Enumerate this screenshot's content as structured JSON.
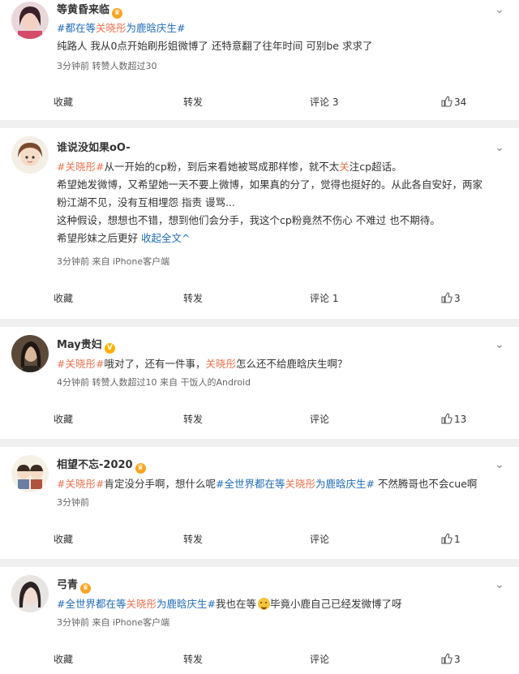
{
  "posts": [
    {
      "username": "等黄昏来临",
      "lines": [
        [
          {
            "t": "#",
            "c": "tag"
          },
          {
            "t": "都在等",
            "c": "tag"
          },
          {
            "t": "关晓彤",
            "c": "hl"
          },
          {
            "t": "为鹿晗庆生#",
            "c": "tag"
          }
        ],
        [
          {
            "t": "纯路人 我从0点开始刷彤姐微博了 还特意翻了往年时间 可别be 求求了",
            "c": ""
          }
        ]
      ],
      "meta": "3分钟前 转赞人数超过30",
      "actions": {
        "fav": "收藏",
        "repost": "转发",
        "comment": "评论 3",
        "like": "34"
      }
    },
    {
      "username": "谁说没如果oO-",
      "lines": [
        [
          {
            "t": "#关晓彤#",
            "c": "hl"
          },
          {
            "t": "从一开始的cp粉，到后来看她被骂成那样惨，就不太",
            "c": ""
          },
          {
            "t": "关",
            "c": "hl"
          },
          {
            "t": "注cp超话。",
            "c": ""
          }
        ],
        [
          {
            "t": "希望她发微博，又希望她一天不要上微博，如果真的分了，觉得也挺好的。从此各自安好，两家",
            "c": ""
          }
        ],
        [
          {
            "t": "粉江湖不见，没有互相埋怨 指责 谩骂...",
            "c": ""
          }
        ],
        [
          {
            "t": "这种假设，想想也不错，想到他们会分手，我这个cp粉竟然不伤心 不难过 也不期待。",
            "c": ""
          }
        ],
        [
          {
            "t": "希望彤妹之后更好 ",
            "c": ""
          },
          {
            "t": "收起全文^",
            "c": "lk"
          }
        ]
      ],
      "meta": "3分钟前 来自 iPhone客户端",
      "actions": {
        "fav": "收藏",
        "repost": "转发",
        "comment": "评论 1",
        "like": "3"
      }
    },
    {
      "username": "May贵妇",
      "lines": [
        [
          {
            "t": "#关晓彤#",
            "c": "hl"
          },
          {
            "t": "哦对了，还有一件事，",
            "c": ""
          },
          {
            "t": "关晓彤",
            "c": "hl"
          },
          {
            "t": "怎么还不给鹿晗庆生啊？",
            "c": ""
          }
        ]
      ],
      "meta": "4分钟前 转赞人数超过10 来自 干饭人的Android",
      "actions": {
        "fav": "收藏",
        "repost": "转发",
        "comment": "评论",
        "like": "13"
      }
    },
    {
      "username": "相望不忘-2020",
      "lines": [
        [
          {
            "t": "#关晓彤#",
            "c": "hl"
          },
          {
            "t": "肯定没分手啊，想什么呢",
            "c": ""
          },
          {
            "t": "#全世界都在等",
            "c": "tag"
          },
          {
            "t": "关晓彤",
            "c": "hl"
          },
          {
            "t": "为鹿晗庆生#",
            "c": "tag"
          },
          {
            "t": " 不然腾哥也不会cue啊",
            "c": ""
          }
        ]
      ],
      "meta": "3分钟前",
      "actions": {
        "fav": "收藏",
        "repost": "转发",
        "comment": "评论",
        "like": "1"
      }
    },
    {
      "username": "弓青",
      "lines": [
        [
          {
            "t": "#全世界都在等",
            "c": "tag"
          },
          {
            "t": "关晓彤",
            "c": "hl"
          },
          {
            "t": "为鹿晗庆生#",
            "c": "tag"
          },
          {
            "t": "我也在等",
            "c": ""
          },
          {
            "t": "EMOJI",
            "c": "emoji"
          },
          {
            "t": "毕竟小鹿自己已经发微博了呀",
            "c": ""
          }
        ]
      ],
      "meta": "3分钟前 来自 iPhone客户端",
      "actions": {
        "fav": "收藏",
        "repost": "转发",
        "comment": "评论",
        "like": "3"
      }
    }
  ],
  "icons": {
    "like": "thumbs-up-icon",
    "more": "chevron-down-icon",
    "badge": "crown-icon"
  },
  "colors": {
    "highlight": "#eb7350",
    "link": "#1e6bb8",
    "separator": "#f0f0f0"
  }
}
